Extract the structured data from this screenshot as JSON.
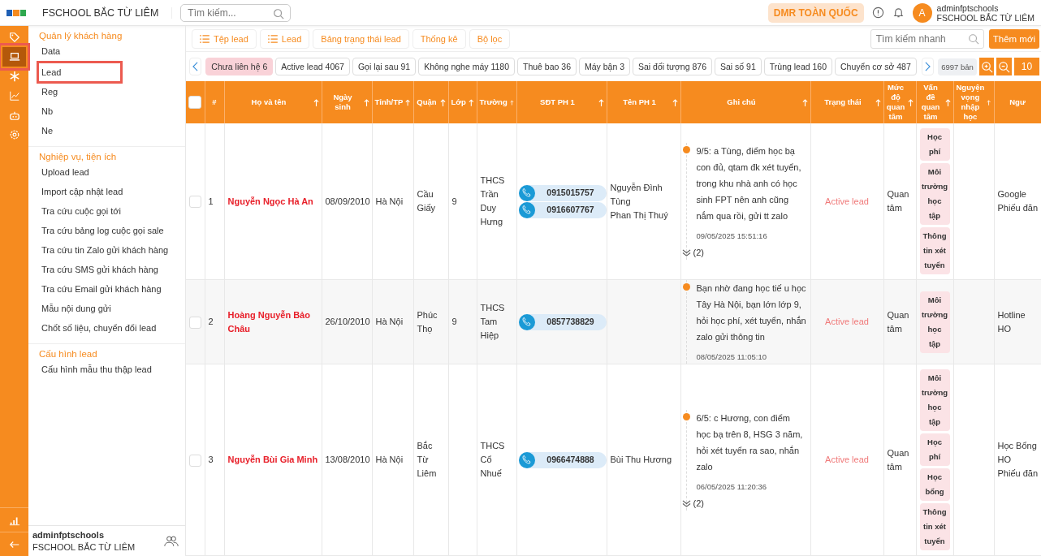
{
  "header": {
    "brand": "FSCHOOL BẮC TỪ LIÊM",
    "search_placeholder": "Tìm kiếm...",
    "region_button": "DMR TOÀN QUỐC",
    "avatar_letter": "A",
    "user_name": "adminfptschools",
    "user_school": "FSCHOOL BẮC TỪ LIÊM"
  },
  "rail": [
    {
      "kind": "tag",
      "selected": false,
      "annotated": false
    },
    {
      "kind": "laptop",
      "selected": true,
      "annotated": true
    },
    {
      "kind": "asterisk",
      "selected": false,
      "annotated": false
    },
    {
      "kind": "chart",
      "selected": false,
      "annotated": false
    },
    {
      "kind": "robot",
      "selected": false,
      "annotated": false
    },
    {
      "kind": "gear",
      "selected": false,
      "annotated": false
    }
  ],
  "rail_bottom": [
    {
      "kind": "bars"
    },
    {
      "kind": "back"
    }
  ],
  "sidebar": {
    "sections": [
      {
        "title": "Quản lý khách hàng",
        "items": [
          {
            "label": "Data",
            "annotated": false
          },
          {
            "label": "Lead",
            "annotated": true
          },
          {
            "label": "Reg",
            "annotated": false
          },
          {
            "label": "Nb",
            "annotated": false
          },
          {
            "label": "Ne",
            "annotated": false
          }
        ]
      },
      {
        "title": "Nghiệp vụ, tiện ích",
        "items": [
          {
            "label": "Upload lead",
            "annotated": false
          },
          {
            "label": "Import cập nhật lead",
            "annotated": false
          },
          {
            "label": "Tra cứu cuộc gọi tới",
            "annotated": false
          },
          {
            "label": "Tra cứu bảng log cuộc gọi sale",
            "annotated": false
          },
          {
            "label": "Tra cứu tin Zalo gửi khách hàng",
            "annotated": false
          },
          {
            "label": "Tra cứu SMS gửi khách hàng",
            "annotated": false
          },
          {
            "label": "Tra cứu Email gửi khách hàng",
            "annotated": false
          },
          {
            "label": "Mẫu nội dung gửi",
            "annotated": false
          },
          {
            "label": "Chốt số liệu, chuyển đổi lead",
            "annotated": false
          }
        ]
      },
      {
        "title": "Cấu hình lead",
        "items": [
          {
            "label": "Cấu hình mẫu thu thập lead",
            "annotated": false
          }
        ]
      }
    ],
    "footer_name": "adminfptschools",
    "footer_school": "FSCHOOL BẮC TỪ LIÊM"
  },
  "toolbar": {
    "buttons": [
      {
        "label": "Tệp lead",
        "icon": true
      },
      {
        "label": "Lead",
        "icon": true
      },
      {
        "label": "Bảng trạng thái lead",
        "icon": false
      },
      {
        "label": "Thống kê",
        "icon": false
      },
      {
        "label": "Bộ lọc",
        "icon": false
      }
    ],
    "search_placeholder": "Tìm kiếm nhanh",
    "add_button": "Thêm mới"
  },
  "filters": [
    {
      "label": "Chưa liên hệ 6",
      "selected": true
    },
    {
      "label": "Active lead 4067",
      "selected": false
    },
    {
      "label": "Gọi lại sau 91",
      "selected": false
    },
    {
      "label": "Không nghe máy 1180",
      "selected": false
    },
    {
      "label": "Thuê bao 36",
      "selected": false
    },
    {
      "label": "Máy bận 3",
      "selected": false
    },
    {
      "label": "Sai đối tượng 876",
      "selected": false
    },
    {
      "label": "Sai số 91",
      "selected": false
    },
    {
      "label": "Trùng lead 160",
      "selected": false
    },
    {
      "label": "Chuyển cơ sở 487",
      "selected": false
    }
  ],
  "record_count": "6997 bản",
  "page_size": "10",
  "table": {
    "columns": [
      {
        "label": "#",
        "sortable": false
      },
      {
        "label": "Họ và tên",
        "sortable": true
      },
      {
        "label": "Ngày sinh",
        "sortable": true
      },
      {
        "label": "Tỉnh/TP",
        "sortable": true
      },
      {
        "label": "Quận",
        "sortable": true
      },
      {
        "label": "Lớp",
        "sortable": true
      },
      {
        "label": "Trường",
        "sortable": true
      },
      {
        "label": "SĐT PH 1",
        "sortable": true
      },
      {
        "label": "Tên PH 1",
        "sortable": true
      },
      {
        "label": "Ghi chú",
        "sortable": true
      },
      {
        "label": "Trạng thái",
        "sortable": true
      },
      {
        "label": "Mức độ quan tâm",
        "sortable": true
      },
      {
        "label": "Vấn đề quan tâm",
        "sortable": true
      },
      {
        "label": "Nguyện vọng nhập học",
        "sortable": true
      },
      {
        "label": "Ngư",
        "sortable": false
      }
    ],
    "header_checked": false,
    "rows": [
      {
        "checked": false,
        "index": "1",
        "name": "Nguyễn Ngọc Hà An",
        "dob": "08/09/2010",
        "province": "Hà Nội",
        "district": "Cầu Giấy",
        "grade": "9",
        "school": "THCS Trần Duy Hưng",
        "phones": [
          "0915015757",
          "0916607767"
        ],
        "parents": [
          "Nguyễn Đình Tùng",
          "Phan Thị Thuý"
        ],
        "note": "9/5: a Tùng, điểm học bạ con đủ, qtam đk xét tuyển, trong khu nhà anh có học sinh FPT nên anh cũng nắm qua rồi, gửi tt zalo",
        "note_time": "09/05/2025 15:51:16",
        "note_more": "(2)",
        "status": "Active lead",
        "interest": "Quan tâm",
        "concerns": [
          "Học phí",
          "Môi trường học tập",
          "Thông tin xét tuyển"
        ],
        "column_15": [
          "Google",
          "Phiếu đăn"
        ]
      },
      {
        "checked": false,
        "index": "2",
        "name": "Hoàng Nguyễn Bảo Châu",
        "dob": "26/10/2010",
        "province": "Hà Nội",
        "district": "Phúc Thọ",
        "grade": "9",
        "school": "THCS Tam Hiệp",
        "phones": [
          "0857738829"
        ],
        "parents": [],
        "note": "Bạn nhờ đang học tiế u học Tây Hà Nội, bạn lớn lớp 9, hỏi học phí, xét tuyển, nhắn zalo gửi thông tin",
        "note_time": "08/05/2025 11:05:10",
        "status": "Active lead",
        "interest": "Quan tâm",
        "concerns": [
          "Môi trường học tập"
        ],
        "column_15": [
          "Hotline",
          "HO"
        ]
      },
      {
        "checked": false,
        "index": "3",
        "name": "Nguyễn Bùi Gia Minh",
        "dob": "13/08/2010",
        "province": "Hà Nội",
        "district": "Bắc Từ Liêm",
        "school": "THCS Cổ Nhuế",
        "phones": [
          "0966474888"
        ],
        "parents": [
          "Bùi Thu Hương"
        ],
        "note": "6/5: c Hương, con điểm học bạ trên 8, HSG 3 năm, hỏi xét tuyển ra sao, nhắn zalo",
        "note_time": "06/05/2025 11:20:36",
        "note_more": "(2)",
        "status": "Active lead",
        "interest": "Quan tâm",
        "concerns": [
          "Môi trường học tập",
          "Học phí",
          "Học bổng",
          "Thông tin xét tuyển"
        ],
        "column_15": [
          "Học Bổng",
          "HO",
          "Phiếu đăn"
        ]
      }
    ]
  }
}
